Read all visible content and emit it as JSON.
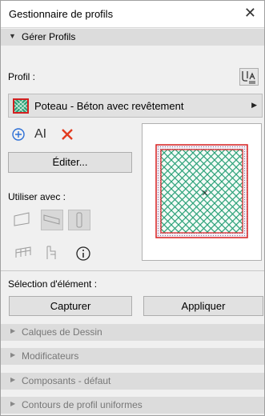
{
  "window": {
    "title": "Gestionnaire de profils",
    "close_glyph": "✕"
  },
  "manage_section": {
    "label": "Gérer Profils",
    "arrow": "▼"
  },
  "profile": {
    "label": "Profil :",
    "selected": "Poteau - Béton avec revêtement",
    "caret": "▶",
    "swatch_fill": "#2da27a",
    "swatch_border": "#d32020"
  },
  "tools": {
    "add_icon": "add-circle-icon",
    "rename_icon": "rename-text-icon",
    "rename_text": "AI",
    "delete_icon": "delete-x-icon",
    "accent": "#2c6fd6",
    "delete_color": "#e23b1f"
  },
  "edit_button": {
    "label": "Éditer..."
  },
  "use_with": {
    "label": "Utiliser avec :",
    "icons": [
      "wall-icon",
      "beam-icon",
      "column-icon",
      "railing-icon",
      "stair-icon",
      "info-icon"
    ]
  },
  "element_selection": {
    "label": "Sélection d'élément :",
    "capture_label": "Capturer",
    "apply_label": "Appliquer"
  },
  "collapsed_sections": [
    {
      "label": "Calques de Dessin"
    },
    {
      "label": "Modificateurs"
    },
    {
      "label": "Composants - défaut"
    },
    {
      "label": "Contours de profil uniformes"
    }
  ],
  "collapsed_arrow": "▶"
}
